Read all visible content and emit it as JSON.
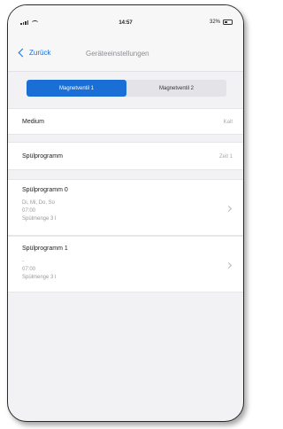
{
  "status": {
    "time": "14:57",
    "battery": "32%"
  },
  "nav": {
    "back_label": "Zurück",
    "title": "Geräteeinstellungen"
  },
  "segments": {
    "left": "Magnetventil 1",
    "right": "Magnetventil 2",
    "selected": "Magnetventil 1"
  },
  "settings": {
    "medium_label": "Medium",
    "medium_value": "Kalt",
    "program_label": "Spülprogramm",
    "program_value": "Zeit 1"
  },
  "programs": [
    {
      "title": "Spülprogramm 0",
      "days": "Di, Mi, Do, So",
      "time": "07:00",
      "amount": "Spülmenge 3 l"
    },
    {
      "title": "Spülprogramm 1",
      "days": "-",
      "time": "07:00",
      "amount": "Spülmenge 3 l"
    }
  ],
  "icons": {
    "signal": "signal-icon",
    "wifi": "wifi-icon",
    "battery": "battery-icon",
    "back": "chevron-left-icon",
    "disclosure": "chevron-right-icon"
  },
  "colors": {
    "accent": "#1a6fd6",
    "background": "#f2f2f4",
    "cell": "#ffffff",
    "secondary_text": "#a8a8ad"
  }
}
